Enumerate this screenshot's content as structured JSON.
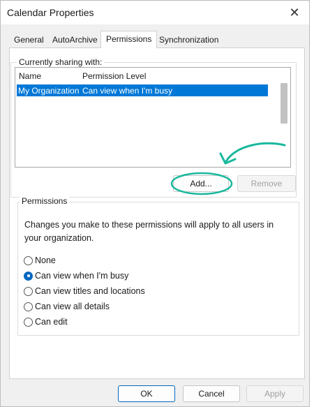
{
  "window": {
    "title": "Calendar Properties"
  },
  "tabs": [
    {
      "label": "General"
    },
    {
      "label": "AutoArchive"
    },
    {
      "label": "Permissions"
    },
    {
      "label": "Synchronization"
    }
  ],
  "sharing": {
    "group_label": "Currently sharing with:",
    "columns": [
      "Name",
      "Permission Level"
    ],
    "rows": [
      {
        "name": "My Organization",
        "level": "Can view when I'm busy",
        "selected": true
      }
    ]
  },
  "buttons": {
    "add": "Add...",
    "remove": "Remove",
    "ok": "OK",
    "cancel": "Cancel",
    "apply": "Apply"
  },
  "permissions": {
    "group_label": "Permissions",
    "description": "Changes you make to these permissions will apply to all users in your organization.",
    "options": [
      {
        "label": "None",
        "checked": false
      },
      {
        "label": "Can view when I'm busy",
        "checked": true
      },
      {
        "label": "Can view titles and locations",
        "checked": false
      },
      {
        "label": "Can view all details",
        "checked": false
      },
      {
        "label": "Can edit",
        "checked": false
      }
    ]
  },
  "colors": {
    "selection": "#0078d7",
    "annotation": "#19b89e",
    "accent": "#0067c0"
  }
}
